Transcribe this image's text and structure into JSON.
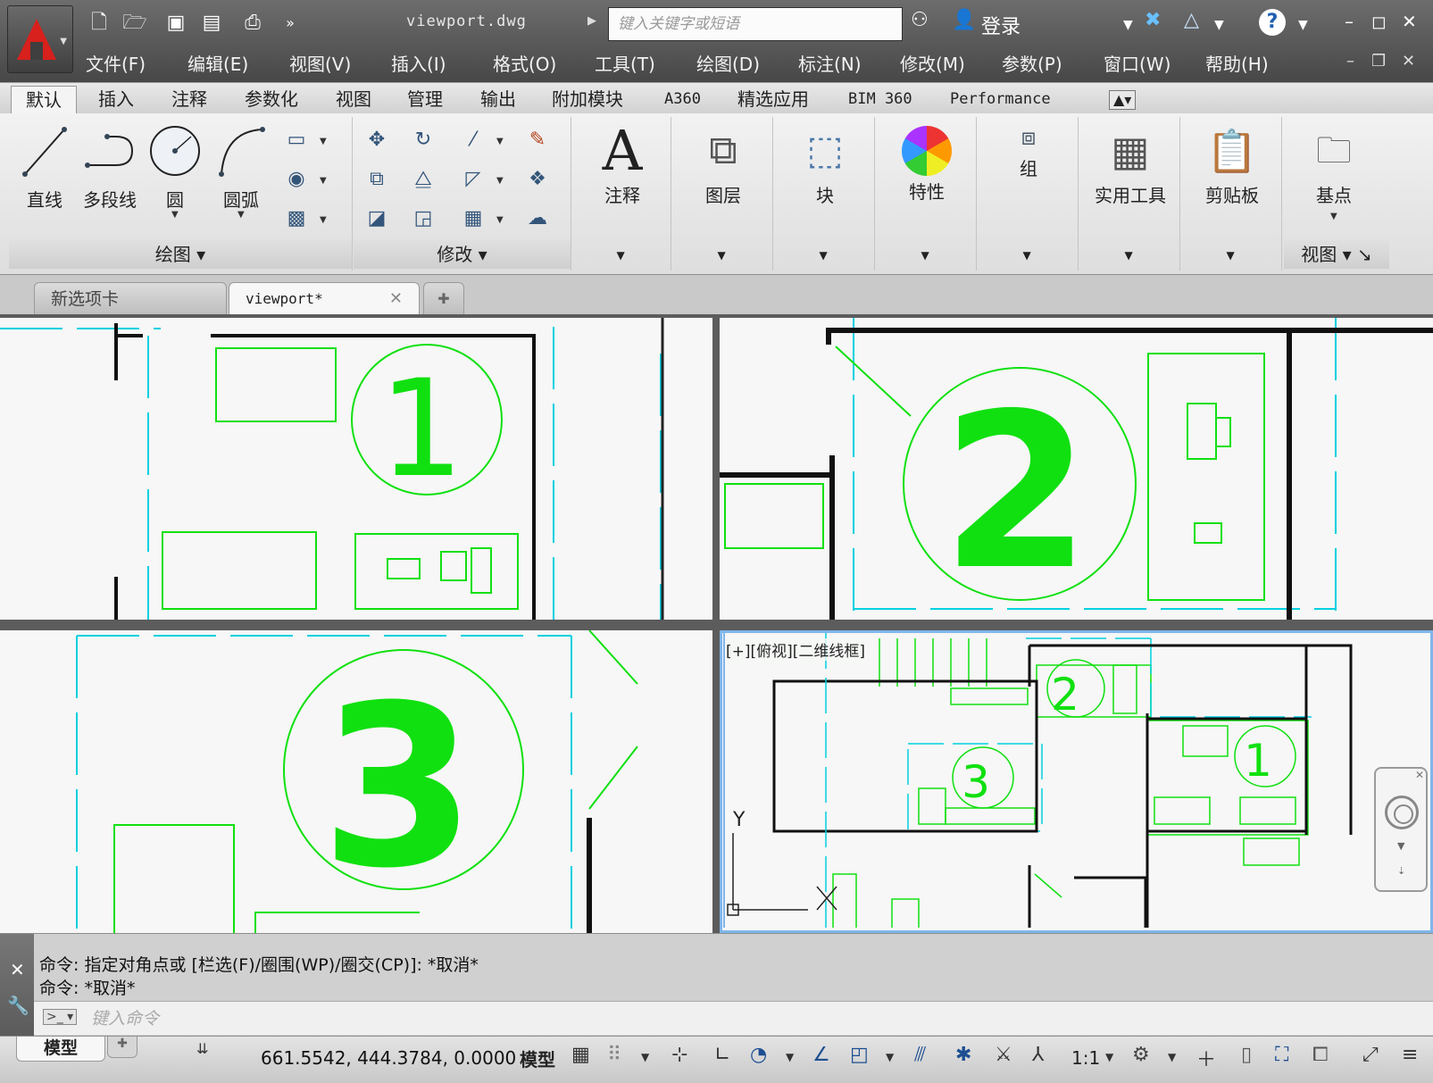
{
  "titlebar": {
    "doc_title": "viewport.dwg",
    "search_placeholder": "键入关键字或短语",
    "login": "登录"
  },
  "menubar": [
    "文件(F)",
    "编辑(E)",
    "视图(V)",
    "插入(I)",
    "格式(O)",
    "工具(T)",
    "绘图(D)",
    "标注(N)",
    "修改(M)",
    "参数(P)",
    "窗口(W)",
    "帮助(H)"
  ],
  "ribbon_tabs": [
    "默认",
    "插入",
    "注释",
    "参数化",
    "视图",
    "管理",
    "输出",
    "附加模块",
    "A360",
    "精选应用",
    "BIM 360",
    "Performance"
  ],
  "ribbon": {
    "draw_tools": [
      "直线",
      "多段线",
      "圆",
      "圆弧"
    ],
    "draw_panel": "绘图",
    "modify_panel": "修改",
    "big_tools": [
      "注释",
      "图层",
      "块",
      "特性",
      "组",
      "实用工具",
      "剪贴板",
      "基点"
    ],
    "view_panel": "视图"
  },
  "doc_tabs": {
    "new_tab": "新选项卡",
    "active_tab": "viewport*"
  },
  "viewports": {
    "vp1_number": "1",
    "vp2_number": "2",
    "vp3_number": "3",
    "vp4_label": "[+][俯视][二维线框]",
    "vp4_numbers": [
      "2",
      "3",
      "1"
    ],
    "axis_y": "Y"
  },
  "command": {
    "line1": "命令: 指定对角点或 [栏选(F)/圈围(WP)/圈交(CP)]: *取消*",
    "line2": "命令: *取消*",
    "input_placeholder": "键入命令"
  },
  "status": {
    "model_tab": "模型",
    "coords": "661.5542, 444.3784, 0.0000",
    "model_label": "模型",
    "scale": "1:1"
  },
  "colors": {
    "entity_green": "#10e010",
    "aux_cyan": "#00d0e0",
    "wall_black": "#111111",
    "active_viewport_border": "#7fb6ea"
  }
}
